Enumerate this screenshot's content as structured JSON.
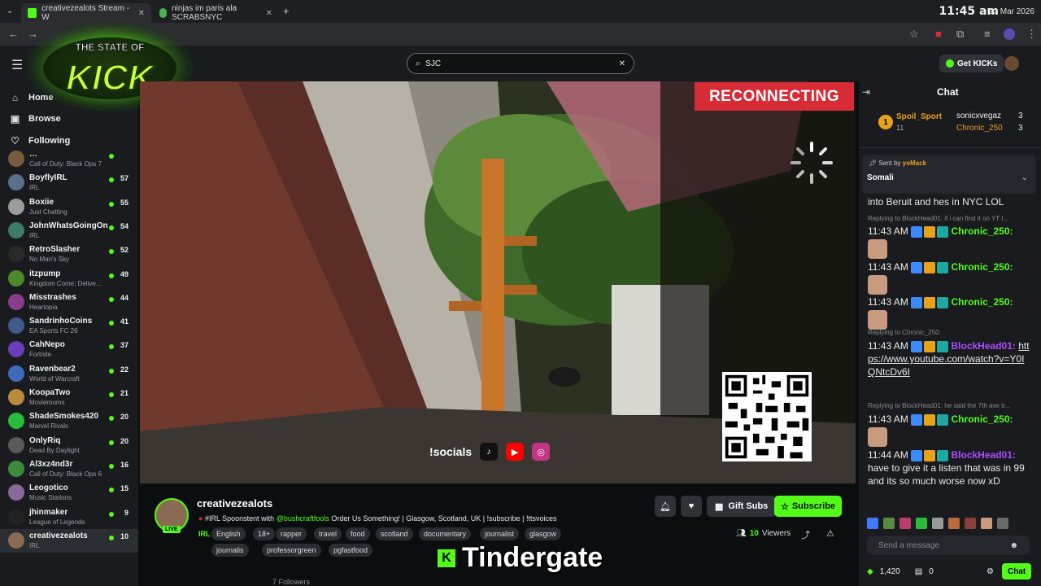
{
  "browser": {
    "tabs": [
      {
        "title": "creativezealots Stream - W",
        "active": true
      },
      {
        "title": "ninjas im paris ala SCRABSNYC",
        "active": false
      }
    ],
    "time": "11:45 am",
    "date": "22 Mar 2026"
  },
  "overlay": {
    "logo_text_top": "THE STATE OF",
    "logo_text_main": "KICK",
    "reconnecting": "RECONNECTING",
    "socials_label": "!socials",
    "caption": "Tindergate"
  },
  "header": {
    "search_value": "SJC",
    "get_kicks": "Get KICKs"
  },
  "sidebar": {
    "nav": [
      {
        "label": "Home",
        "icon": "home-icon"
      },
      {
        "label": "Browse",
        "icon": "browse-icon"
      },
      {
        "label": "Following",
        "icon": "heart-icon"
      }
    ],
    "channels": [
      {
        "name": "…",
        "game": "Call of Duty: Black Ops 7",
        "viewers": "",
        "color": "#7a5c3d"
      },
      {
        "name": "BoyflyIRL",
        "game": "IRL",
        "viewers": "57",
        "color": "#5a6f8a"
      },
      {
        "name": "Boxiie",
        "game": "Just Chatting",
        "viewers": "55",
        "color": "#9c9c9c"
      },
      {
        "name": "JohnWhatsGoingOn",
        "game": "IRL",
        "viewers": "54",
        "color": "#3d7a6a"
      },
      {
        "name": "RetroSlasher",
        "game": "No Man's Sky",
        "viewers": "52",
        "color": "#2a2a2a"
      },
      {
        "name": "itzpump",
        "game": "Kingdom Come: Delive...",
        "viewers": "49",
        "color": "#4a8a2a"
      },
      {
        "name": "Misstrashes",
        "game": "Heartopia",
        "viewers": "44",
        "color": "#8a3d8a"
      },
      {
        "name": "SandrinhoCoins",
        "game": "EA Sports FC 26",
        "viewers": "41",
        "color": "#3d5a8a"
      },
      {
        "name": "CahNepo",
        "game": "Fortnite",
        "viewers": "37",
        "color": "#6a3dba"
      },
      {
        "name": "Ravenbear2",
        "game": "World of Warcraft",
        "viewers": "22",
        "color": "#3d6aba"
      },
      {
        "name": "KoopaTwo",
        "game": "Movierooms",
        "viewers": "21",
        "color": "#ba8a3d"
      },
      {
        "name": "ShadeSmokes420",
        "game": "Marvel Rivals",
        "viewers": "20",
        "color": "#2aba3d"
      },
      {
        "name": "OnlyRiq",
        "game": "Dead By Daylight",
        "viewers": "20",
        "color": "#5a5a5a"
      },
      {
        "name": "Al3xz4nd3r",
        "game": "Call of Duty: Black Ops 6",
        "viewers": "16",
        "color": "#3d8a3d"
      },
      {
        "name": "Leogotico",
        "game": "Music Stations",
        "viewers": "15",
        "color": "#8a6a9a"
      },
      {
        "name": "jhinmaker",
        "game": "League of Legends",
        "viewers": "9",
        "color": "#222222"
      },
      {
        "name": "creativezealots",
        "game": "IRL",
        "viewers": "10",
        "color": "#8a6a50"
      }
    ]
  },
  "stream": {
    "name": "creativezealots",
    "live": "LIVE",
    "title_prefix": "#IRL Spoonstent with ",
    "title_handle": "@bushcraftfools",
    "title_suffix": " Order Us Something! | Glasgow, Scotland, UK | !subscribe | !ttsvoices",
    "category": "IRL",
    "tags": [
      "English",
      "18+",
      "rapper",
      "travel",
      "food",
      "scotland",
      "documentary",
      "journalist",
      "glasgow"
    ],
    "tags2": [
      "journalis",
      "professorgreen",
      "pgfastfood"
    ],
    "gift_subs": "Gift Subs",
    "subscribe": "Subscribe",
    "viewers_count": "10",
    "viewers_label": "Viewers",
    "followers": "7 Followers"
  },
  "chat": {
    "title": "Chat",
    "leaders": [
      {
        "rank": "1",
        "name": "Spoil_Sport",
        "count": "11"
      },
      {
        "name": "sonicxvegaz",
        "count": "3"
      },
      {
        "name": "Chronic_250",
        "count": "3"
      }
    ],
    "pinned": {
      "sent_by": "Sent by",
      "sender": "yoMack",
      "text": "Somali"
    },
    "messages": [
      {
        "text": "into Beruit and hes in NYC LOL"
      },
      {
        "reply": "Replying to BlockHead01: if i can find it on YT I..."
      },
      {
        "time": "11:43 AM",
        "user": "Chronic_250:",
        "color": "g"
      },
      {
        "time": "11:43 AM",
        "user": "Chronic_250:",
        "color": "g"
      },
      {
        "time": "11:43 AM",
        "user": "Chronic_250:",
        "color": "g"
      },
      {
        "reply": "Replying to Chronic_250:"
      },
      {
        "time": "11:43 AM",
        "user": "BlockHead01:",
        "color": "p",
        "text": "https://www.youtube.com/watch?v=Y0IQNtcDv6I"
      },
      {
        "reply": "Replying to BlockHead01: he said the 7th ave tr..."
      },
      {
        "time": "11:43 AM",
        "user": "Chronic_250:",
        "color": "g"
      },
      {
        "time": "11:44 AM",
        "user": "BlockHead01:",
        "color": "p",
        "text": "have to give it a listen that was in 99 and its so much worse now xD"
      }
    ],
    "input_placeholder": "Send a message",
    "points": "1,420",
    "drops": "0",
    "chat_button": "Chat"
  },
  "colors": {
    "kick_green": "#53fc18",
    "reconnect_red": "#d72b36",
    "bg": "#0b0e0f",
    "panel": "#191b1f"
  }
}
